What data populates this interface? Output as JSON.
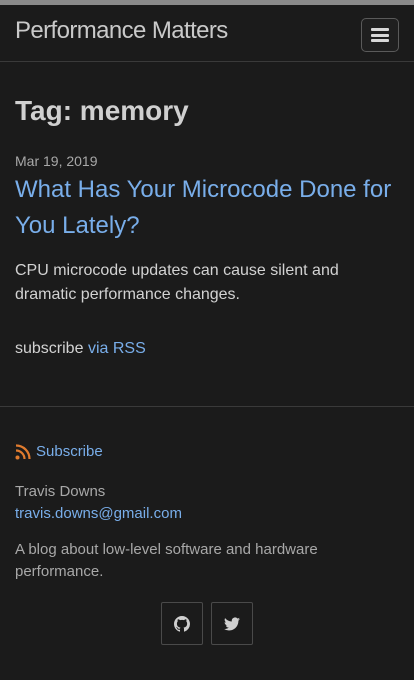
{
  "header": {
    "site_title": "Performance Matters",
    "menu_icon": "hamburger-icon"
  },
  "main": {
    "tag_heading": "Tag: memory",
    "posts": [
      {
        "date": "Mar 19, 2019",
        "title": "What Has Your Microcode Done for You Lately?",
        "excerpt": "CPU microcode updates can cause silent and dramatic performance changes."
      }
    ],
    "subscribe_prefix": "subscribe",
    "subscribe_link": "via RSS"
  },
  "footer": {
    "subscribe_label": "Subscribe",
    "subscribe_icon": "rss-icon",
    "author_name": "Travis Downs",
    "author_email": "travis.downs@gmail.com",
    "description": "A blog about low-level software and hardware performance.",
    "social": [
      {
        "icon": "github-icon"
      },
      {
        "icon": "twitter-icon"
      }
    ]
  },
  "colors": {
    "background": "#1b1b1b",
    "link": "#79aeea",
    "text": "#d2d2d2",
    "muted": "#a8a8a8"
  }
}
